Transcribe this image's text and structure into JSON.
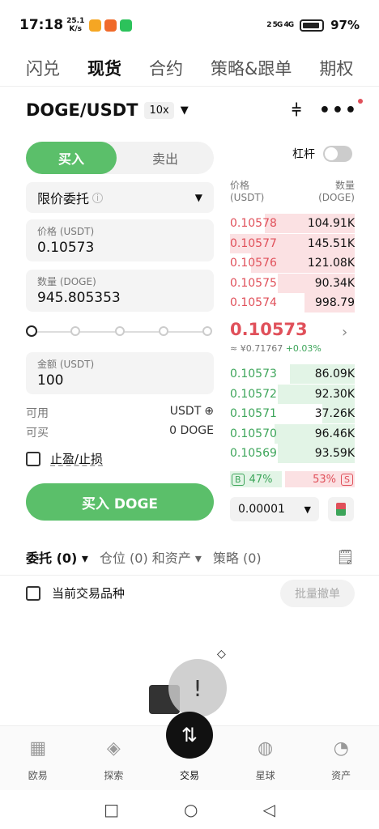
{
  "status": {
    "time": "17:18",
    "speed": "25.1",
    "speed_unit": "K/s",
    "network": "2 5G 4G",
    "battery": "97%"
  },
  "toptabs": [
    "闪兑",
    "现货",
    "合约",
    "策略&跟单",
    "期权"
  ],
  "pair": {
    "name": "DOGE/USDT",
    "leverage": "10x"
  },
  "trade": {
    "buy_tab": "买入",
    "sell_tab": "卖出",
    "order_type": "限价委托",
    "price_label": "价格 (USDT)",
    "price_value": "0.10573",
    "qty_label": "数量 (DOGE)",
    "qty_value": "945.805353",
    "amount_label": "金额 (USDT)",
    "amount_value": "100",
    "available_label": "可用",
    "available_value": "USDT",
    "canbuy_label": "可买",
    "canbuy_value": "0 DOGE",
    "tpsl_label": "止盈/止损",
    "buy_button": "买入 DOGE",
    "slider_level": 0
  },
  "margin_label": "杠杆",
  "orderbook": {
    "price_header": "价格\n(USDT)",
    "qty_header": "数量\n(DOGE)",
    "asks": [
      {
        "price": "0.10578",
        "qty": "104.91K",
        "depth": 0.72
      },
      {
        "price": "0.10577",
        "qty": "145.51K",
        "depth": 1.0
      },
      {
        "price": "0.10576",
        "qty": "121.08K",
        "depth": 0.83
      },
      {
        "price": "0.10575",
        "qty": "90.34K",
        "depth": 0.62
      },
      {
        "price": "0.10574",
        "qty": "998.79",
        "depth": 0.4
      }
    ],
    "last_price": "0.10573",
    "fiat": "≈ ¥0.71767",
    "change": "+0.03%",
    "bids": [
      {
        "price": "0.10573",
        "qty": "86.09K",
        "depth": 0.52
      },
      {
        "price": "0.10572",
        "qty": "92.30K",
        "depth": 0.62
      },
      {
        "price": "0.10571",
        "qty": "37.26K",
        "depth": 0.26
      },
      {
        "price": "0.10570",
        "qty": "96.46K",
        "depth": 0.64
      },
      {
        "price": "0.10569",
        "qty": "93.59K",
        "depth": 0.62
      }
    ],
    "buy_ratio": "47%",
    "sell_ratio": "53%",
    "buy_badge": "B",
    "sell_badge": "S",
    "precision": "0.00001"
  },
  "ordertabs": {
    "orders": "委托 (0)",
    "positions": "仓位 (0) 和资产",
    "strategy": "策略 (0)"
  },
  "current_pair_label": "当前交易品种",
  "cancel_all": "批量撤单",
  "nav": [
    "欧易",
    "探索",
    "交易",
    "星球",
    "资产"
  ],
  "colors": {
    "buy": "#5bbf6a",
    "sell": "#e0505a"
  }
}
